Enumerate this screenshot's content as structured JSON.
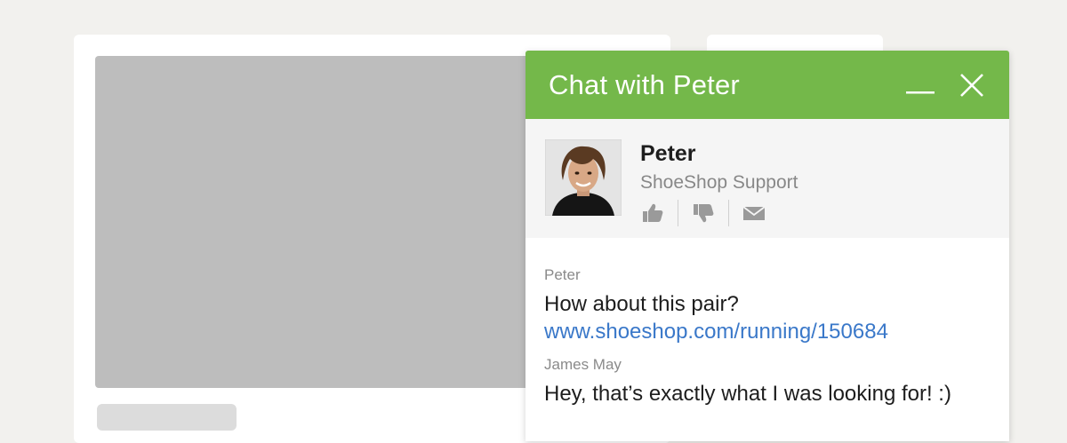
{
  "chat": {
    "title": "Chat with Peter",
    "controls": {
      "minimize_icon": "minimize-icon",
      "close_icon": "close-icon"
    },
    "accent_color": "#74b84a",
    "link_color": "#3a78c9"
  },
  "agent": {
    "name": "Peter",
    "role": "ShoeShop Support",
    "actions": [
      "thumbs-up-icon",
      "thumbs-down-icon",
      "envelope-icon"
    ]
  },
  "messages": [
    {
      "author": "Peter",
      "text": "How about this pair?",
      "link": "www.shoeshop.com/running/150684"
    },
    {
      "author": "James May",
      "text": "Hey, that’s exactly what I was looking for! :)"
    }
  ]
}
